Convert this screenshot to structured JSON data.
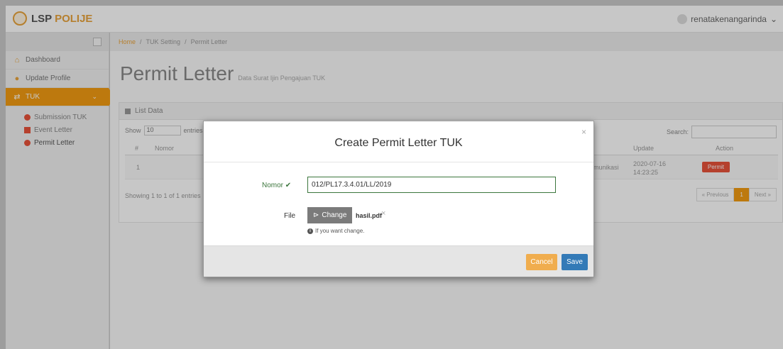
{
  "header": {
    "brand_prefix": "LSP ",
    "brand_accent": "POLIJE",
    "username": "renatakenangarinda",
    "caret": "⌄"
  },
  "breadcrumb": {
    "items": [
      "Home",
      "/",
      "TUK Setting",
      "/",
      "Permit Letter"
    ]
  },
  "sidebar": {
    "items": [
      {
        "icon": "⌂",
        "label": "Dashboard"
      },
      {
        "icon": "●",
        "label": "Update Profile"
      },
      {
        "icon": "⇄",
        "label": "TUK"
      }
    ],
    "tuk_caret": "⌄",
    "subitems": [
      {
        "label": "Submission TUK"
      },
      {
        "label": "Event Letter"
      },
      {
        "label": "Permit Letter"
      }
    ]
  },
  "page": {
    "title": "Permit Letter",
    "subtitle": "Data Surat Ijin Pengajuan TUK"
  },
  "panel": {
    "title": "List Data",
    "show_label": "Show",
    "entries_value": "10",
    "entries_label": "entries",
    "search_label": "Search:",
    "columns": {
      "num": "#",
      "nomor": "Nomor",
      "update": "Update",
      "action": "Action"
    },
    "row": {
      "num": "1",
      "partial": "munikasi",
      "update": "2020-07-16 14:23:25",
      "action": "Permit"
    },
    "info": "Showing 1 to 1 of 1 entries",
    "pager": {
      "prev": "« Previous",
      "current": "1",
      "next": "Next »"
    }
  },
  "modal": {
    "title": "Create Permit Letter TUK",
    "close": "×",
    "nomor_label": "Nomor ✔",
    "nomor_value": "012/PL17.3.4.01/LL/2019",
    "file_label": "File",
    "change_label": "Change",
    "file_name": "hasil.pdf",
    "remove": "×",
    "hint": "If you want change.",
    "cancel_label": "Cancel",
    "save_label": "Save"
  },
  "colors": {
    "accent": "#f39c12",
    "danger": "#e8523a",
    "success": "#3c763d",
    "primary": "#337ab7",
    "warning": "#f0ad4e"
  }
}
